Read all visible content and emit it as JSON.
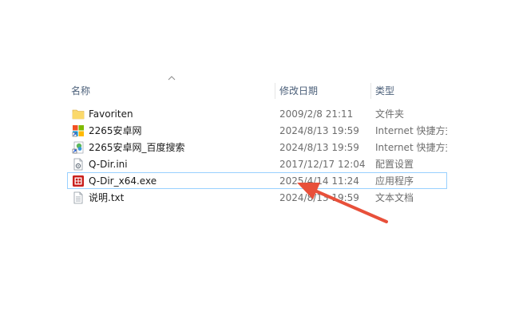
{
  "header": {
    "name_label": "名称",
    "date_label": "修改日期",
    "type_label": "类型"
  },
  "files": [
    {
      "name": "Favoriten",
      "date": "2009/2/8 21:11",
      "type": "文件夹",
      "icon": "folder-icon",
      "selected": false
    },
    {
      "name": "2265安卓网",
      "date": "2024/8/13 19:59",
      "type": "Internet 快捷方式",
      "icon": "internet-shortcut-icon",
      "selected": false
    },
    {
      "name": "2265安卓网_百度搜索",
      "date": "2024/8/13 19:59",
      "type": "Internet 快捷方式",
      "icon": "internet-shortcut-green-icon",
      "selected": false
    },
    {
      "name": "Q-Dir.ini",
      "date": "2017/12/17 12:04",
      "type": "配置设置",
      "icon": "ini-file-icon",
      "selected": false
    },
    {
      "name": "Q-Dir_x64.exe",
      "date": "2025/4/14 11:24",
      "type": "应用程序",
      "icon": "exe-app-icon",
      "selected": true
    },
    {
      "name": "说明.txt",
      "date": "2024/8/13 19:59",
      "type": "文本文档",
      "icon": "text-file-icon",
      "selected": false
    }
  ],
  "colors": {
    "selection_border": "#99d1ff",
    "arrow": "#e8503a",
    "folder": "#f8d775"
  }
}
